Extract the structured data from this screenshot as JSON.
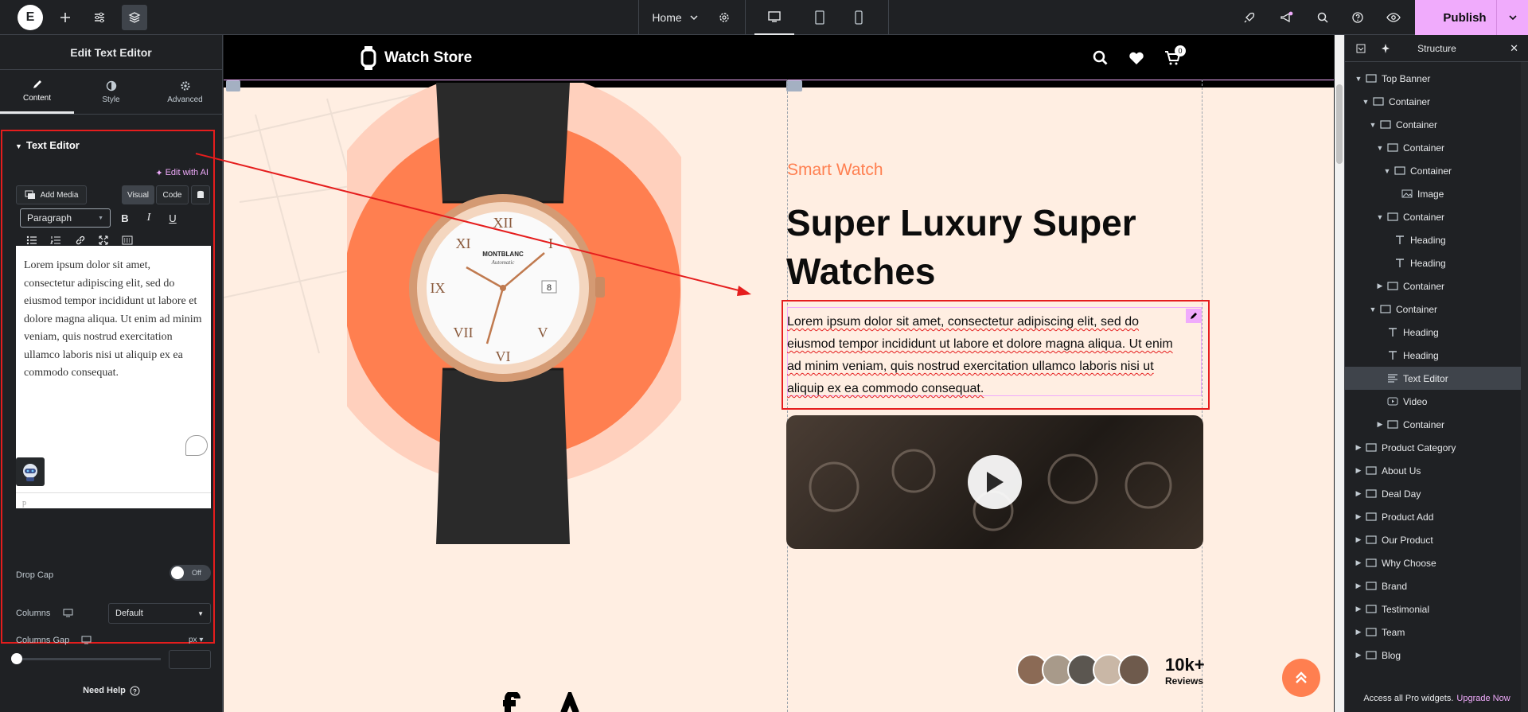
{
  "topbar": {
    "logo": "E",
    "page_selector": "Home",
    "publish_label": "Publish"
  },
  "left_panel": {
    "title": "Edit Text Editor",
    "tabs": [
      {
        "label": "Content",
        "icon": "pencil-icon"
      },
      {
        "label": "Style",
        "icon": "half-circle-icon"
      },
      {
        "label": "Advanced",
        "icon": "gear-icon"
      }
    ],
    "section_title": "Text Editor",
    "edit_with_ai": "Edit with AI",
    "add_media": "Add Media",
    "visual_tab": "Visual",
    "code_tab": "Code",
    "paragraph_select": "Paragraph",
    "editor_text": "Lorem ipsum dolor sit amet, consectetur adipiscing elit, sed do eiusmod tempor incididunt ut labore et dolore magna aliqua. Ut enim ad minim veniam, quis nostrud exercitation ullamco laboris nisi ut aliquip ex ea commodo consequat.",
    "editor_footer": "p",
    "drop_cap_label": "Drop Cap",
    "drop_cap_state": "Off",
    "columns_label": "Columns",
    "columns_value": "Default",
    "columns_gap_label": "Columns Gap",
    "columns_gap_unit": "px",
    "columns_gap_value": 0,
    "need_help": "Need Help"
  },
  "canvas": {
    "site_name": "Watch Store",
    "cart_count": "0",
    "kicker": "Smart Watch",
    "headline_line1": "Super Luxury Super",
    "headline_line2": "Watches",
    "body_line1": "Lorem ipsum dolor sit amet, consectetur adipiscing elit, sed do",
    "body_line2": "eiusmod tempor incididunt ut labore et dolore magna aliqua. Ut enim",
    "body_line3": "ad minim veniam, quis nostrud exercitation ullamco laboris nisi ut",
    "body_line4": "aliquip ex ea commodo consequat.",
    "watch_brand": "MONTBLANC",
    "watch_model": "Automatic",
    "watch_date": "8",
    "reviews_count": "10k+",
    "reviews_label": "Reviews",
    "colors": {
      "accent": "#ff7f50",
      "background": "#ffeee2",
      "header": "#000000"
    }
  },
  "structure_panel": {
    "title": "Structure",
    "items": [
      {
        "label": "Top Banner",
        "icon": "container-icon",
        "level": 0,
        "open": true
      },
      {
        "label": "Container",
        "icon": "container-icon",
        "level": 1,
        "open": true
      },
      {
        "label": "Container",
        "icon": "container-icon",
        "level": 2,
        "open": true
      },
      {
        "label": "Container",
        "icon": "container-icon",
        "level": 3,
        "open": true
      },
      {
        "label": "Container",
        "icon": "container-icon",
        "level": 4,
        "open": true
      },
      {
        "label": "Image",
        "icon": "image-icon",
        "level": 5,
        "open": null
      },
      {
        "label": "Container",
        "icon": "container-icon",
        "level": 3,
        "open": true
      },
      {
        "label": "Heading",
        "icon": "heading-icon",
        "level": 4,
        "open": null
      },
      {
        "label": "Heading",
        "icon": "heading-icon",
        "level": 4,
        "open": null
      },
      {
        "label": "Container",
        "icon": "container-icon",
        "level": 3,
        "open": false
      },
      {
        "label": "Container",
        "icon": "container-icon",
        "level": 2,
        "open": true
      },
      {
        "label": "Heading",
        "icon": "heading-icon",
        "level": 3,
        "open": null
      },
      {
        "label": "Heading",
        "icon": "heading-icon",
        "level": 3,
        "open": null
      },
      {
        "label": "Text Editor",
        "icon": "text-editor-icon",
        "level": 3,
        "open": null,
        "selected": true
      },
      {
        "label": "Video",
        "icon": "video-icon",
        "level": 3,
        "open": null
      },
      {
        "label": "Container",
        "icon": "container-icon",
        "level": 3,
        "open": false
      },
      {
        "label": "Product Category",
        "icon": "container-icon",
        "level": 0,
        "open": false
      },
      {
        "label": "About Us",
        "icon": "container-icon",
        "level": 0,
        "open": false
      },
      {
        "label": "Deal Day",
        "icon": "container-icon",
        "level": 0,
        "open": false
      },
      {
        "label": "Product Add",
        "icon": "container-icon",
        "level": 0,
        "open": false
      },
      {
        "label": "Our Product",
        "icon": "container-icon",
        "level": 0,
        "open": false
      },
      {
        "label": "Why Choose",
        "icon": "container-icon",
        "level": 0,
        "open": false
      },
      {
        "label": "Brand",
        "icon": "container-icon",
        "level": 0,
        "open": false
      },
      {
        "label": "Testimonial",
        "icon": "container-icon",
        "level": 0,
        "open": false
      },
      {
        "label": "Team",
        "icon": "container-icon",
        "level": 0,
        "open": false
      },
      {
        "label": "Blog",
        "icon": "container-icon",
        "level": 0,
        "open": false
      }
    ],
    "footer_text": "Access all Pro widgets.",
    "footer_link": "Upgrade Now"
  }
}
